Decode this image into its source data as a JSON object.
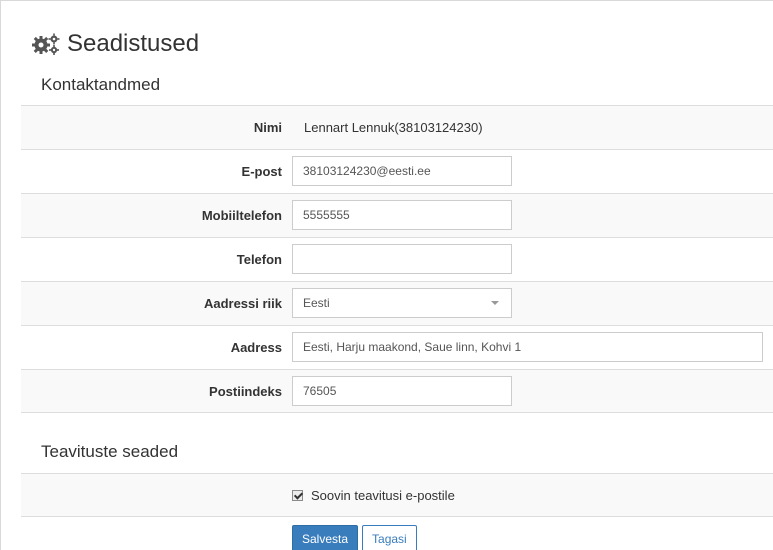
{
  "page": {
    "title": "Seadistused",
    "title_icon": "gears-icon"
  },
  "contact": {
    "section_title": "Kontaktandmed",
    "name": {
      "label": "Nimi",
      "value": "Lennart Lennuk(38103124230)"
    },
    "email": {
      "label": "E-post",
      "value": "38103124230@eesti.ee"
    },
    "mobile": {
      "label": "Mobiiltelefon",
      "value": "5555555"
    },
    "phone": {
      "label": "Telefon",
      "value": ""
    },
    "country": {
      "label": "Aadressi riik",
      "selected": "Eesti"
    },
    "address": {
      "label": "Aadress",
      "value": "Eesti, Harju maakond, Saue linn, Kohvi 1"
    },
    "postal": {
      "label": "Postiindeks",
      "value": "76505"
    }
  },
  "notifications": {
    "section_title": "Teavituste seaded",
    "email_checkbox_label": "Soovin teavitusi e-postile",
    "email_checked": true
  },
  "actions": {
    "save_label": "Salvesta",
    "back_label": "Tagasi"
  },
  "colors": {
    "primary": "#3a7dbd",
    "row_stripe": "#f9f9f9",
    "border": "#dddddd"
  }
}
